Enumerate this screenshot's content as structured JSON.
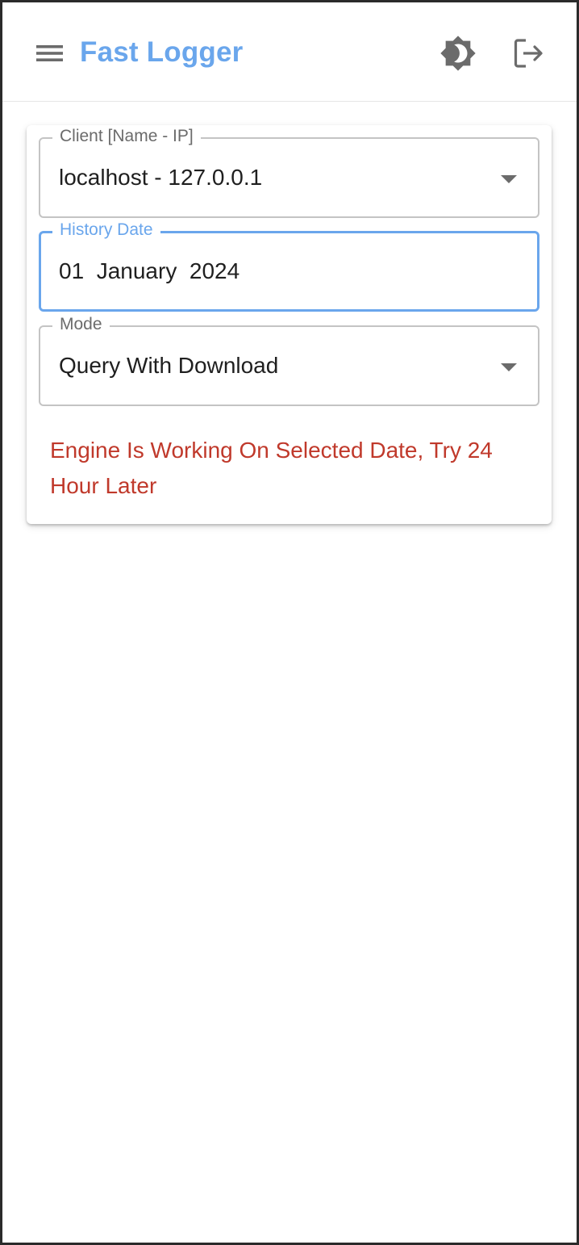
{
  "app_bar": {
    "title": "Fast Logger",
    "menu_icon": "hamburger-menu-icon",
    "theme_icon": "brightness-icon",
    "logout_icon": "logout-icon",
    "accent_color": "#6aa6ec"
  },
  "form": {
    "client": {
      "label": "Client [Name - IP]",
      "value": "localhost - 127.0.0.1"
    },
    "history_date": {
      "label": "History Date",
      "value": "01  January  2024",
      "focused": true
    },
    "mode": {
      "label": "Mode",
      "value": "Query With Download"
    },
    "error_message": "Engine Is Working On Selected Date, Try 24 Hour Later",
    "error_color": "#c0392b"
  }
}
